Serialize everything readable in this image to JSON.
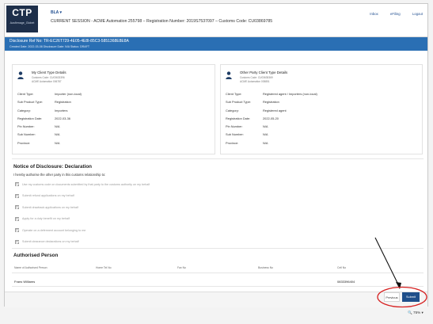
{
  "header": {
    "logo": "CTP",
    "logo_sub": "Ausfirmage_Globet",
    "user_menu": "BLA",
    "session": "CURRENT SESSION - ACME Automation 255798 – Registration Number: 2019S7537097 – Customs Code: CU03869785",
    "links": [
      "Inbox",
      "eFiling",
      "Logout"
    ]
  },
  "banner": {
    "title": "Disclosure Ref No: TR-EC26T729-4E05-4E8I-85C3-5851368E8E8A",
    "meta": "Created Date: 2022-03-08  Disclosure Date: N/A  Status: DRAFT"
  },
  "my_client": {
    "title": "My Client Type Details",
    "line1": "Customs Code: CU03633396",
    "line2": "ACME Automation 006787",
    "rows": [
      {
        "k": "Client Type:",
        "v": "Importer (non-local)"
      },
      {
        "k": "Sub Product Type:",
        "v": "Registration"
      },
      {
        "k": "Category:",
        "v": "Importers"
      },
      {
        "k": "Registration Date:",
        "v": "2022-03-36"
      },
      {
        "k": "Pin Number:",
        "v": "N/A"
      },
      {
        "k": "Sub Number:",
        "v": "N/A"
      },
      {
        "k": "Province:",
        "v": "N/A"
      }
    ]
  },
  "other_party": {
    "title": "Other Party Client Type Details",
    "line1": "Customs Code: CU03635369",
    "line2": "ACME Automation 005851",
    "rows": [
      {
        "k": "Client Type:",
        "v": "Registered agent / Importers (non-local)"
      },
      {
        "k": "Sub Product Type:",
        "v": "Registration"
      },
      {
        "k": "Category:",
        "v": "Registered agent"
      },
      {
        "k": "Registration Date:",
        "v": "2022-05-20"
      },
      {
        "k": "Pin Number:",
        "v": "N/A"
      },
      {
        "k": "Sub Number:",
        "v": "N/A"
      },
      {
        "k": "Province:",
        "v": "N/A"
      }
    ]
  },
  "declaration": {
    "title": "Notice of Disclosure: Declaration",
    "intro": "I hereby authorise the other party in this customs relationship to:",
    "items": [
      "Use my customs code on documents submitted by that party to the customs authority on my behalf",
      "Submit refund applications on my behalf",
      "Submit drawback applications on my behalf",
      "Apply for a duty benefit on my behalf",
      "Operate on a deferment account belonging to me",
      "Submit clearance declarations on my behalf"
    ]
  },
  "authorised": {
    "title": "Authorised Person",
    "headers": [
      "Name of Authorised Person",
      "Home Tel No",
      "Fax No",
      "Business No",
      "Cell No"
    ],
    "row": [
      "Frans Williams",
      "",
      "",
      "",
      "0833396404"
    ]
  },
  "footer": {
    "previous": "Previous",
    "submit": "Submit"
  },
  "zoom": "75%"
}
